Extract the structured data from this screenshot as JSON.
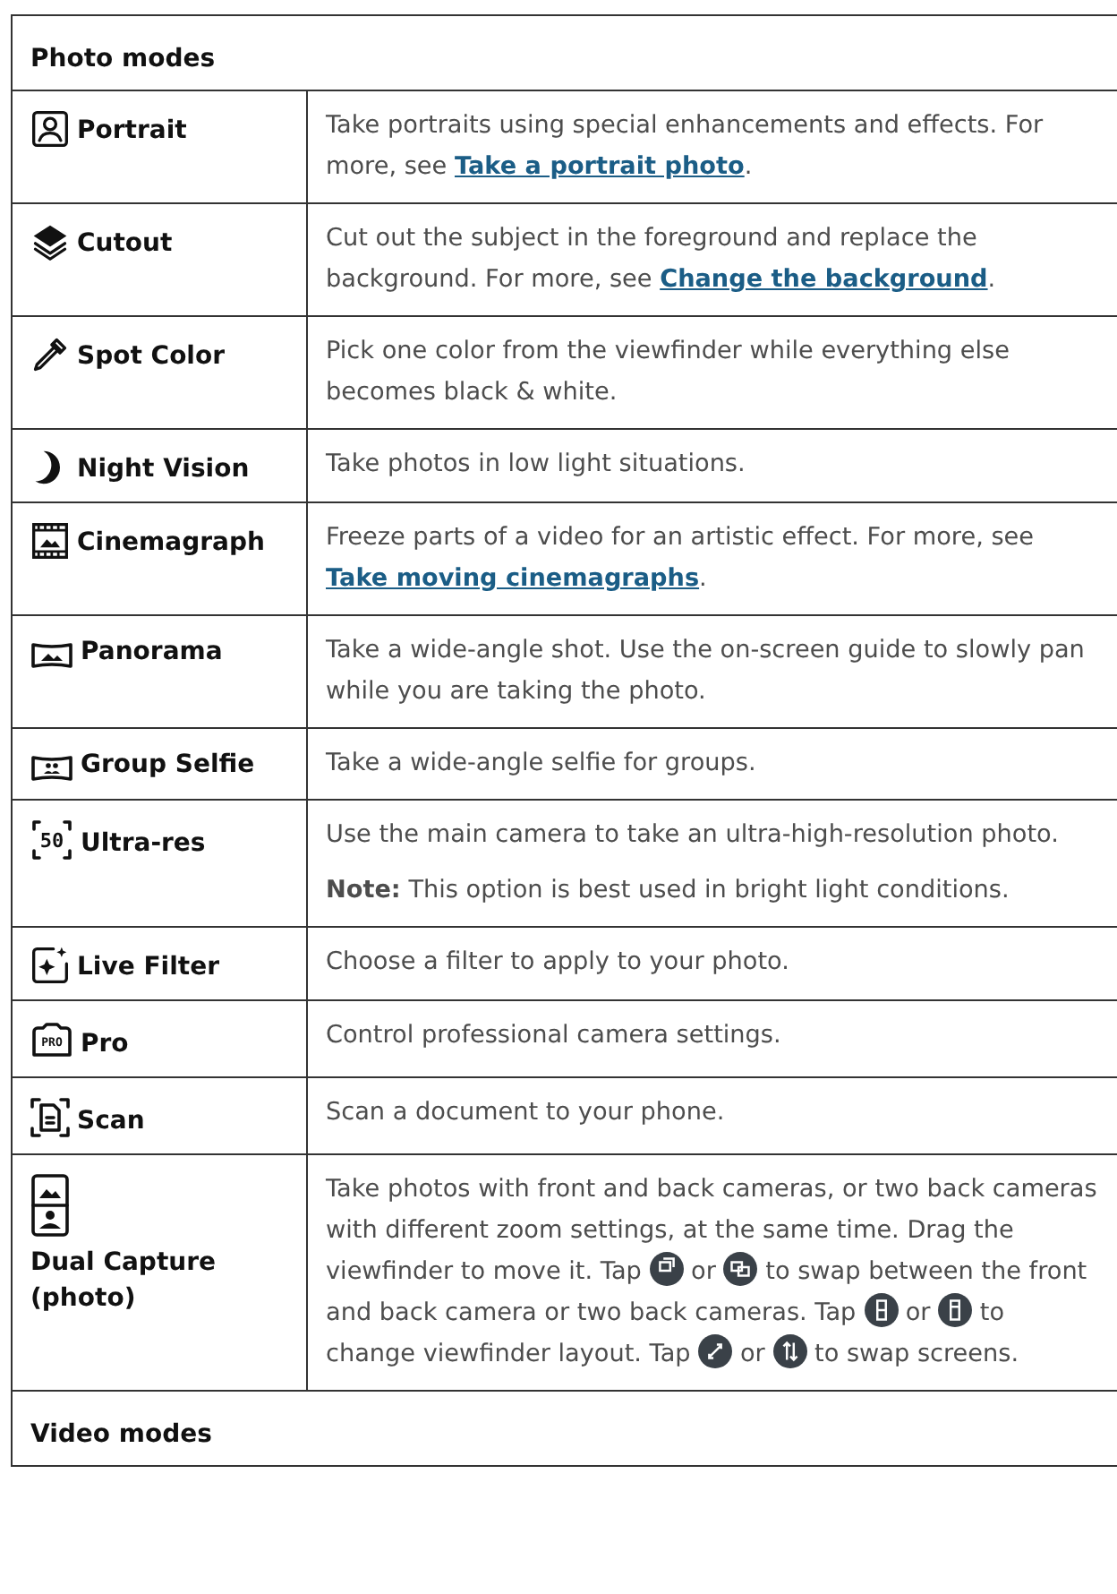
{
  "sections": [
    {
      "title": "Photo modes",
      "rows": [
        {
          "mode": "Portrait",
          "description": [
            [
              {
                "kind": "text",
                "text": "Take portraits using special enhancements and effects. For more, see "
              },
              {
                "kind": "link",
                "text": "Take a portrait photo"
              },
              {
                "kind": "text",
                "text": "."
              }
            ]
          ]
        },
        {
          "mode": "Cutout",
          "description": [
            [
              {
                "kind": "text",
                "text": "Cut out the subject in the foreground and replace the background. For more, see "
              },
              {
                "kind": "link",
                "text": "Change the background"
              },
              {
                "kind": "text",
                "text": "."
              }
            ]
          ]
        },
        {
          "mode": "Spot Color",
          "description": [
            [
              {
                "kind": "text",
                "text": "Pick one color from the viewfinder while everything else becomes black & white."
              }
            ]
          ]
        },
        {
          "mode": "Night Vision",
          "description": [
            [
              {
                "kind": "text",
                "text": "Take photos in low light situations."
              }
            ]
          ]
        },
        {
          "mode": "Cinemagraph",
          "description": [
            [
              {
                "kind": "text",
                "text": "Freeze parts of a video for an artistic effect. For more, see "
              },
              {
                "kind": "link",
                "text": "Take moving cinemagraphs"
              },
              {
                "kind": "text",
                "text": "."
              }
            ]
          ]
        },
        {
          "mode": "Panorama",
          "description": [
            [
              {
                "kind": "text",
                "text": "Take a wide-angle shot. Use the on-screen guide to slowly pan while you are taking the photo."
              }
            ]
          ]
        },
        {
          "mode": "Group Selfie",
          "description": [
            [
              {
                "kind": "text",
                "text": "Take a wide-angle selfie for groups."
              }
            ]
          ]
        },
        {
          "mode": "Ultra-res",
          "icon_text": "50",
          "description": [
            [
              {
                "kind": "text",
                "text": "Use the main camera to take an ultra-high-resolution photo."
              }
            ],
            [
              {
                "kind": "text",
                "text": "**Note:** This option is best used in bright light conditions."
              }
            ]
          ]
        },
        {
          "mode": "Live Filter",
          "description": [
            [
              {
                "kind": "text",
                "text": "Choose a filter to apply to your photo."
              }
            ]
          ]
        },
        {
          "mode": "Pro",
          "icon_text": "PRO",
          "description": [
            [
              {
                "kind": "text",
                "text": "Control professional camera settings."
              }
            ]
          ]
        },
        {
          "mode": "Scan",
          "description": [
            [
              {
                "kind": "text",
                "text": "Scan a document to your phone."
              }
            ]
          ]
        },
        {
          "mode": "Dual Capture (photo)",
          "description": [
            [
              {
                "kind": "text",
                "text": "Take photos with front and back cameras, or two back cameras with different zoom settings, at the same time. Drag the viewfinder to move it. Tap "
              },
              {
                "kind": "icon"
              },
              {
                "kind": "text",
                "text": " or "
              },
              {
                "kind": "icon"
              },
              {
                "kind": "text",
                "text": " to swap between the front and back camera or two back cameras. Tap "
              },
              {
                "kind": "icon"
              },
              {
                "kind": "text",
                "text": " or "
              },
              {
                "kind": "icon"
              },
              {
                "kind": "text",
                "text": " to change viewfinder layout. Tap "
              },
              {
                "kind": "icon"
              },
              {
                "kind": "text",
                "text": " or "
              },
              {
                "kind": "icon"
              },
              {
                "kind": "text",
                "text": " to swap screens."
              }
            ]
          ]
        }
      ]
    },
    {
      "title": "Video modes"
    }
  ]
}
